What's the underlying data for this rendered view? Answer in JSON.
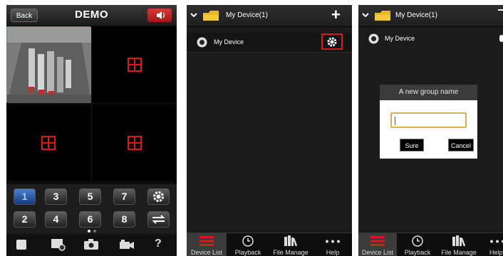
{
  "screen1": {
    "back_label": "Back",
    "title": "DEMO",
    "speaker_icon": "speaker-icon",
    "number_keys_top": [
      "1",
      "3",
      "5",
      "7"
    ],
    "number_keys_bottom": [
      "2",
      "4",
      "6",
      "8"
    ],
    "settings_icon": "gear-icon",
    "swap_icon": "swap-arrows-icon",
    "page_dots": 2,
    "toolbar_icons": [
      "stop-icon",
      "record-icon",
      "camera-icon",
      "video-camera-icon",
      "help-icon"
    ],
    "help_glyph": "?"
  },
  "screen2": {
    "group_name": "My Device(1)",
    "device_name": "My Device",
    "add_glyph": "+",
    "tabs": [
      "Device List",
      "Playback",
      "File Manage",
      "Help"
    ]
  },
  "screen3": {
    "group_name": "My Device(1)",
    "device_name": "My Device",
    "dialog_title": "A new group name",
    "input_value": "",
    "sure_label": "Sure",
    "cancel_label": "Cancel",
    "tabs": [
      "Device List",
      "Playback",
      "File Manage",
      "Help"
    ]
  },
  "colors": {
    "accent_red": "#d81a1a",
    "folder_yellow": "#e8b825",
    "input_border": "#d9b253"
  }
}
